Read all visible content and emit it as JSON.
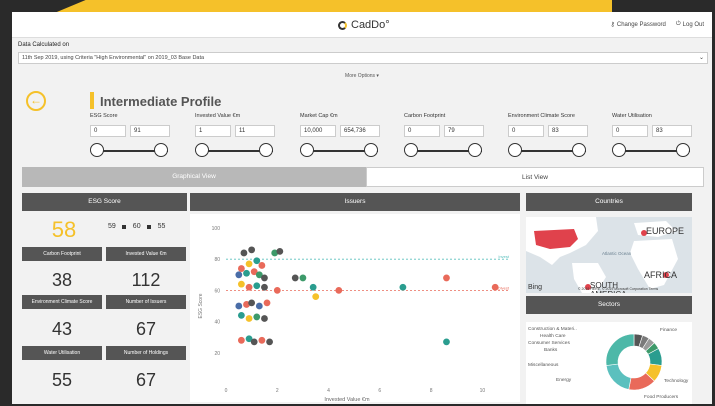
{
  "app": {
    "brand": "CadDo°",
    "change_password": "Change Password",
    "logout": "Log Out"
  },
  "data_calc": {
    "label": "Data Calculated on",
    "value": "11th Sep 2019, using Criteria \"High Environmental\" on 2019_03 Base Data",
    "more_options": "More Options ▾"
  },
  "profile": {
    "title": "Intermediate Profile"
  },
  "filters": [
    {
      "label": "ESG Score",
      "min": "0",
      "max": "91"
    },
    {
      "label": "Invested Value €m",
      "min": "1",
      "max": "11"
    },
    {
      "label": "Market Cap €m",
      "min": "10,000",
      "max": "654,736"
    },
    {
      "label": "Carbon Footprint",
      "min": "0",
      "max": "79"
    },
    {
      "label": "Environment Climate Score",
      "min": "0",
      "max": "83"
    },
    {
      "label": "Water Utilisation",
      "min": "0",
      "max": "83"
    }
  ],
  "tabs": {
    "graphical": "Graphical View",
    "list": "List View"
  },
  "panels": {
    "esg": "ESG Score",
    "issuers": "Issuers",
    "countries": "Countries",
    "sectors": "Sectors"
  },
  "metrics": {
    "esg_score": "58",
    "legend": [
      "59",
      "60",
      "55"
    ],
    "carbon_label": "Carbon Footprint",
    "carbon_value": "38",
    "invested_label": "Invested Value €m",
    "invested_value": "112",
    "env_label": "Environment Climate Score",
    "env_value": "43",
    "issuers_label": "Number of Issuers",
    "issuers_value": "67",
    "water_label": "Water Utilisation",
    "water_value": "55",
    "holdings_label": "Number of Holdings",
    "holdings_value": "67"
  },
  "map": {
    "labels": [
      "EUROPE",
      "AFRICA",
      "SOUTH AMERICA",
      "Atlantic Ocean"
    ],
    "bing": "Bing",
    "copyright": "© 2019 HERE, © 2019 Microsoft Corporation Terms"
  },
  "chart_data": {
    "type": "scatter",
    "xlabel": "Invested Value €m",
    "xsub": "Size by Market Cap",
    "ylabel": "ESG Score",
    "xlim": [
      0,
      11
    ],
    "ylim": [
      0,
      100
    ],
    "xticks": [
      0,
      2,
      4,
      6,
      8,
      10
    ],
    "yticks": [
      20,
      40,
      60,
      80,
      100
    ],
    "ref_lines": [
      {
        "name": "Invest",
        "y": 80,
        "color": "#5bc0be"
      },
      {
        "name": "Divest",
        "y": 60,
        "color": "#e96a5a"
      }
    ],
    "points": [
      {
        "x": 0.7,
        "y": 84,
        "c": "#555555"
      },
      {
        "x": 1.0,
        "y": 86,
        "c": "#555555"
      },
      {
        "x": 1.9,
        "y": 84,
        "c": "#3d9a6a"
      },
      {
        "x": 2.1,
        "y": 85,
        "c": "#555555"
      },
      {
        "x": 0.6,
        "y": 74,
        "c": "#e96a5a"
      },
      {
        "x": 0.9,
        "y": 77,
        "c": "#f5c12a"
      },
      {
        "x": 1.2,
        "y": 79,
        "c": "#2a9d8f"
      },
      {
        "x": 1.4,
        "y": 76,
        "c": "#e96a5a"
      },
      {
        "x": 0.5,
        "y": 70,
        "c": "#4a6da7"
      },
      {
        "x": 0.8,
        "y": 71,
        "c": "#2a9d8f"
      },
      {
        "x": 1.1,
        "y": 72,
        "c": "#e96a5a"
      },
      {
        "x": 1.3,
        "y": 70,
        "c": "#3d9a6a"
      },
      {
        "x": 1.5,
        "y": 68,
        "c": "#555555"
      },
      {
        "x": 2.7,
        "y": 68,
        "c": "#555555"
      },
      {
        "x": 3.0,
        "y": 68,
        "c": "#3d9a6a"
      },
      {
        "x": 0.6,
        "y": 64,
        "c": "#f5c12a"
      },
      {
        "x": 0.9,
        "y": 62,
        "c": "#e96a5a"
      },
      {
        "x": 1.2,
        "y": 63,
        "c": "#2a9d8f"
      },
      {
        "x": 1.5,
        "y": 62,
        "c": "#555555"
      },
      {
        "x": 2.0,
        "y": 60,
        "c": "#e96a5a"
      },
      {
        "x": 3.4,
        "y": 62,
        "c": "#2a9d8f"
      },
      {
        "x": 3.5,
        "y": 56,
        "c": "#f5c12a"
      },
      {
        "x": 4.4,
        "y": 60,
        "c": "#e96a5a"
      },
      {
        "x": 6.9,
        "y": 62,
        "c": "#2a9d8f"
      },
      {
        "x": 8.6,
        "y": 68,
        "c": "#e96a5a"
      },
      {
        "x": 10.5,
        "y": 62,
        "c": "#e96a5a"
      },
      {
        "x": 0.5,
        "y": 50,
        "c": "#4a6da7"
      },
      {
        "x": 0.8,
        "y": 51,
        "c": "#e96a5a"
      },
      {
        "x": 1.0,
        "y": 52,
        "c": "#555555"
      },
      {
        "x": 1.3,
        "y": 50,
        "c": "#4a6da7"
      },
      {
        "x": 1.6,
        "y": 52,
        "c": "#e96a5a"
      },
      {
        "x": 0.6,
        "y": 44,
        "c": "#2a9d8f"
      },
      {
        "x": 0.9,
        "y": 42,
        "c": "#f5c12a"
      },
      {
        "x": 1.2,
        "y": 43,
        "c": "#3d9a6a"
      },
      {
        "x": 1.5,
        "y": 42,
        "c": "#555555"
      },
      {
        "x": 0.6,
        "y": 28,
        "c": "#e96a5a"
      },
      {
        "x": 0.9,
        "y": 29,
        "c": "#2a9d8f"
      },
      {
        "x": 1.1,
        "y": 27,
        "c": "#555555"
      },
      {
        "x": 1.4,
        "y": 28,
        "c": "#e96a5a"
      },
      {
        "x": 1.7,
        "y": 27,
        "c": "#555555"
      },
      {
        "x": 8.6,
        "y": 27,
        "c": "#2a9d8f"
      }
    ]
  },
  "sector_data": {
    "type": "pie",
    "categories": [
      "Construction & Materi..",
      "Health Care",
      "Consumer Services",
      "Banks",
      "Miscellaneous",
      "Energy",
      "Food Producers",
      "Technology",
      "Finance"
    ],
    "values": [
      5,
      4,
      4,
      4,
      10,
      10,
      16,
      20,
      27
    ],
    "colors": [
      "#555555",
      "#7a7a7a",
      "#9a9a9a",
      "#3d9a6a",
      "#2a9d8f",
      "#f5c12a",
      "#e96a5a",
      "#5bc0be",
      "#4db8a8"
    ]
  }
}
